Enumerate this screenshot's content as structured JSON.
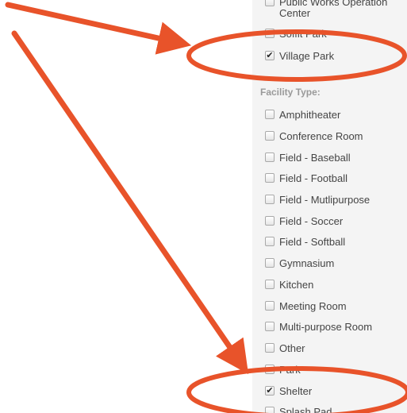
{
  "location_list": {
    "items": [
      {
        "label_line1": "Public Works Operation",
        "label_line2": "Center",
        "checked": false
      },
      {
        "label": "Soffit Park",
        "checked": false
      },
      {
        "label": "Village Park",
        "checked": true
      }
    ]
  },
  "facility": {
    "heading": "Facility Type:",
    "items": [
      {
        "label": "Amphitheater",
        "checked": false
      },
      {
        "label": "Conference Room",
        "checked": false
      },
      {
        "label": "Field - Baseball",
        "checked": false
      },
      {
        "label": "Field - Football",
        "checked": false
      },
      {
        "label": "Field - Mutlipurpose",
        "checked": false
      },
      {
        "label": "Field - Soccer",
        "checked": false
      },
      {
        "label": "Field - Softball",
        "checked": false
      },
      {
        "label": "Gymnasium",
        "checked": false
      },
      {
        "label": "Kitchen",
        "checked": false
      },
      {
        "label": "Meeting Room",
        "checked": false
      },
      {
        "label": "Multi-purpose Room",
        "checked": false
      },
      {
        "label": "Other",
        "checked": false
      },
      {
        "label": "Park",
        "checked": false
      },
      {
        "label": "Shelter",
        "checked": true
      },
      {
        "label": "Splash Pad",
        "checked": false
      }
    ]
  },
  "annotation_color": "#e8532a",
  "check_glyph": "✔"
}
